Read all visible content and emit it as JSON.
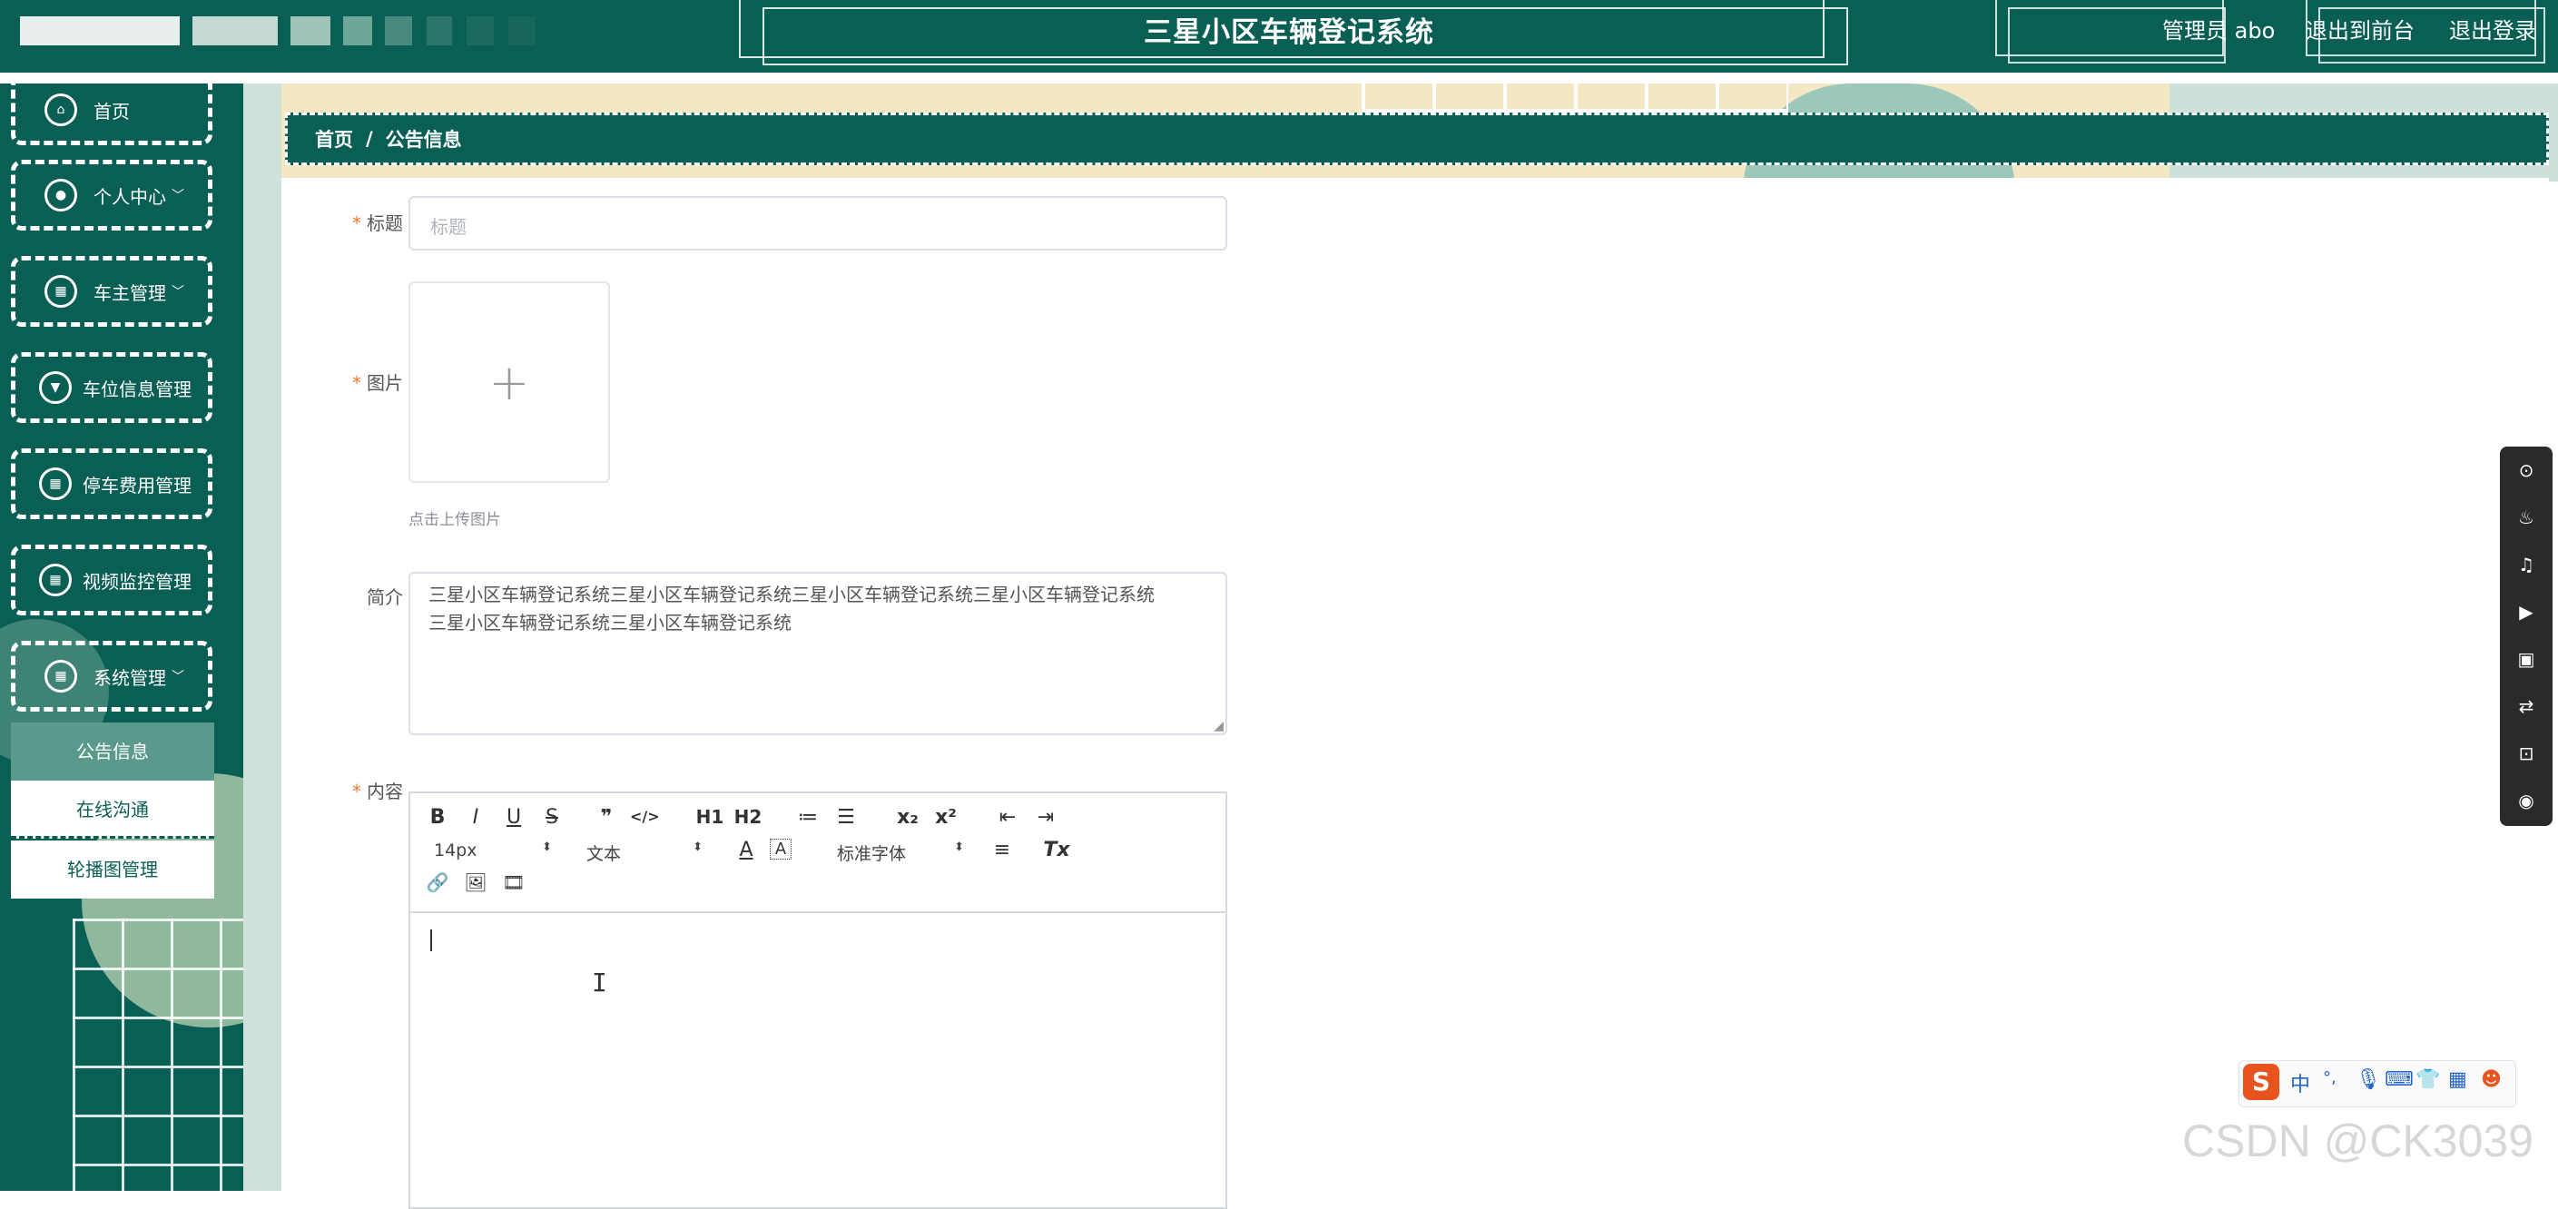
{
  "header": {
    "title": "三星小区车辆登记系统",
    "user_label": "管理员 abo",
    "back_front_label": "退出到前台",
    "logout_label": "退出登录"
  },
  "sidebar": {
    "items": [
      {
        "label": "首页",
        "icon": "home-icon",
        "has_dropdown": false
      },
      {
        "label": "个人中心",
        "icon": "user-icon",
        "has_dropdown": true
      },
      {
        "label": "车主管理",
        "icon": "grid-icon",
        "has_dropdown": true
      },
      {
        "label": "车位信息管理",
        "icon": "parking-icon",
        "has_dropdown": false
      },
      {
        "label": "停车费用管理",
        "icon": "grid-icon",
        "has_dropdown": false
      },
      {
        "label": "视频监控管理",
        "icon": "grid-icon",
        "has_dropdown": false
      },
      {
        "label": "系统管理",
        "icon": "grid-icon",
        "has_dropdown": true
      }
    ],
    "sub_items": [
      {
        "label": "公告信息",
        "active": true
      },
      {
        "label": "在线沟通",
        "active": false
      },
      {
        "label": "轮播图管理",
        "active": false
      }
    ]
  },
  "breadcrumb": {
    "home": "首页",
    "separator": "/",
    "current": "公告信息"
  },
  "form": {
    "title_label": "标题",
    "title_placeholder": "标题",
    "image_label": "图片",
    "upload_plus": "+",
    "upload_tip": "点击上传图片",
    "intro_label": "简介",
    "intro_value": "三星小区车辆登记系统三星小区车辆登记系统三星小区车辆登记系统三星小区车辆登记系统\n三星小区车辆登记系统三星小区车辆登记系统",
    "content_label": "内容",
    "required_mark": "*"
  },
  "editor": {
    "buttons_row1": [
      "B",
      "I",
      "U",
      "S",
      "❞",
      "</>",
      "H1",
      "H2",
      "≔",
      "☰",
      "x₂",
      "x²",
      "⇤",
      "⇥"
    ],
    "font_size": "14px",
    "paragraph": "文本",
    "font_family": "标准字体",
    "buttons_row2_extra": [
      "A",
      "A",
      "≡",
      "Tx"
    ],
    "buttons_row3": [
      "🔗",
      "🖼",
      "🎞"
    ]
  },
  "side_tools": [
    "search-icon",
    "flame-icon",
    "music-icon",
    "video-icon",
    "crop-icon",
    "swap-icon",
    "screenshot-icon",
    "camera-icon"
  ],
  "ime": {
    "logo": "S",
    "mode": "中",
    "punct": "°,"
  },
  "watermark": "CSDN @CK3039",
  "colors": {
    "primary": "#0a5f54",
    "accent_required": "#e8763b",
    "submenu_active_bg": "#5a9a8c"
  }
}
